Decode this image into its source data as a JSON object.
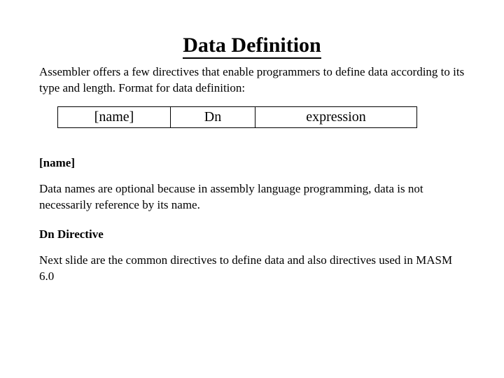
{
  "title": "Data Definition",
  "intro": "Assembler offers a few directives that enable programmers to define data according to its type and length. Format for data definition:",
  "format": {
    "col1": "[name]",
    "col2": "Dn",
    "col3": "expression"
  },
  "sections": [
    {
      "heading": "[name]",
      "body": "Data names are optional because in assembly language programming, data is not necessarily reference by its name."
    },
    {
      "heading": "Dn Directive",
      "body": "Next slide are the common directives to define data and also directives used in MASM 6.0"
    }
  ]
}
